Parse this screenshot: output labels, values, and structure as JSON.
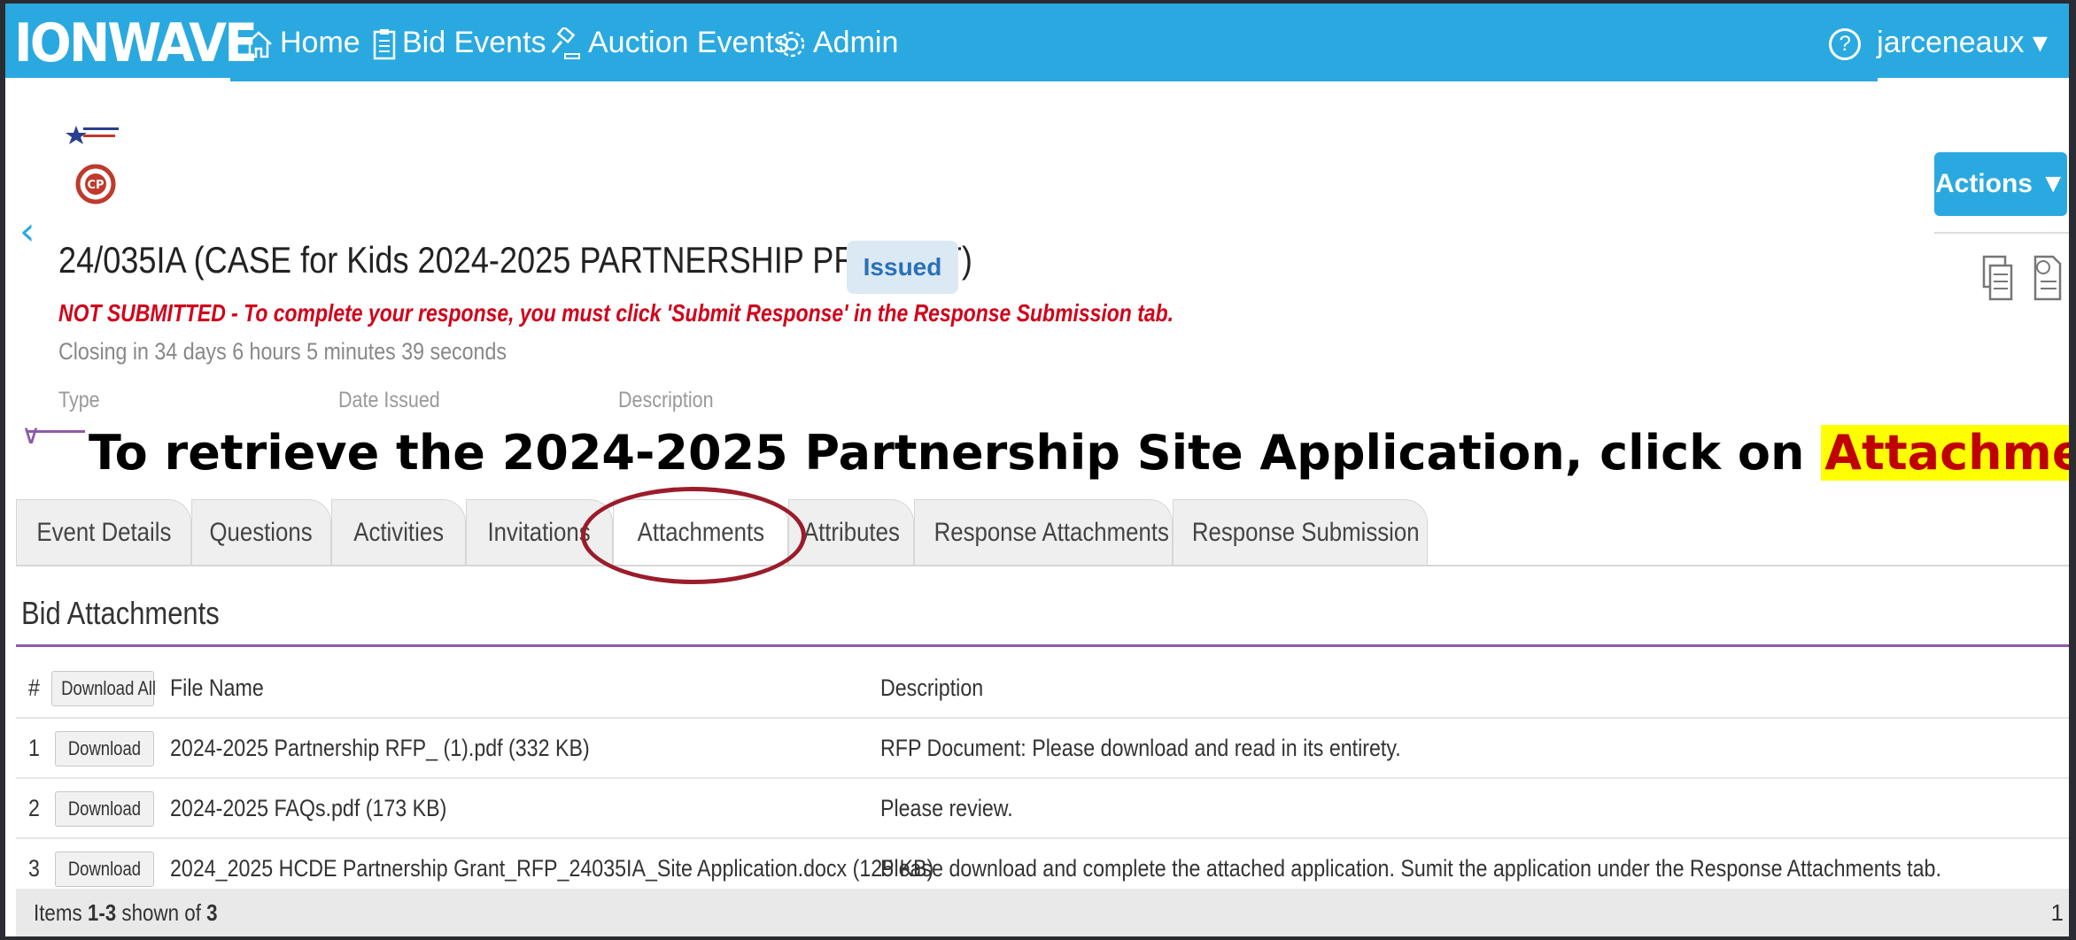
{
  "nav": {
    "logo": "IONWAVE",
    "items": [
      {
        "label": "Home",
        "icon": "home-icon"
      },
      {
        "label": "Bid Events",
        "icon": "clipboard-icon"
      },
      {
        "label": "Auction Events",
        "icon": "gavel-icon"
      },
      {
        "label": "Admin",
        "icon": "gear-icon"
      }
    ],
    "help": "?",
    "user": "jarceneaux ▾"
  },
  "header": {
    "title": "24/035IA (CASE for Kids 2024-2025 PARTNERSHIP PROJECT)",
    "status": "Issued",
    "warning": "NOT SUBMITTED - To complete your response, you must click 'Submit Response' in the Response Submission tab.",
    "closing": "Closing in 34 days 6 hours 5 minutes 39 seconds",
    "meta_labels": [
      "Type",
      "Date Issued",
      "Description"
    ],
    "actions": "Actions ▼"
  },
  "annotation": {
    "text": "To retrieve the 2024-2025 Partnership Site Application, click on ",
    "highlight": "Attachments",
    "end": "."
  },
  "tabs": [
    "Event Details",
    "Questions",
    "Activities",
    "Invitations",
    "Attachments",
    "Attributes",
    "Response Attachments",
    "Response Submission"
  ],
  "active_tab": "Attachments",
  "section": {
    "title": "Bid Attachments",
    "headers": {
      "num": "#",
      "download_all": "Download All",
      "file": "File Name",
      "desc": "Description"
    },
    "rows": [
      {
        "num": "1",
        "btn": "Download",
        "file": "2024-2025 Partnership RFP_ (1).pdf (332 KB)",
        "desc": "RFP Document: Please download and read in its entirety."
      },
      {
        "num": "2",
        "btn": "Download",
        "file": "2024-2025 FAQs.pdf (173 KB)",
        "desc": "Please review."
      },
      {
        "num": "3",
        "btn": "Download",
        "file": "2024_2025 HCDE Partnership Grant_RFP_24035IA_Site Application.docx (125 KB)",
        "desc": "Please download and complete the attached application. Sumit the application under the Response Attachments tab."
      }
    ],
    "footer_pre": "Items ",
    "footer_range": "1-3",
    "footer_mid": " shown of ",
    "footer_total": "3",
    "page": "1"
  },
  "colors": {
    "nav_bg": "#2aa9e0",
    "accent_purple": "#8e5aa8",
    "warning_red": "#d0021b",
    "circle": "#9b1c2a",
    "highlight": "#ffff00"
  }
}
